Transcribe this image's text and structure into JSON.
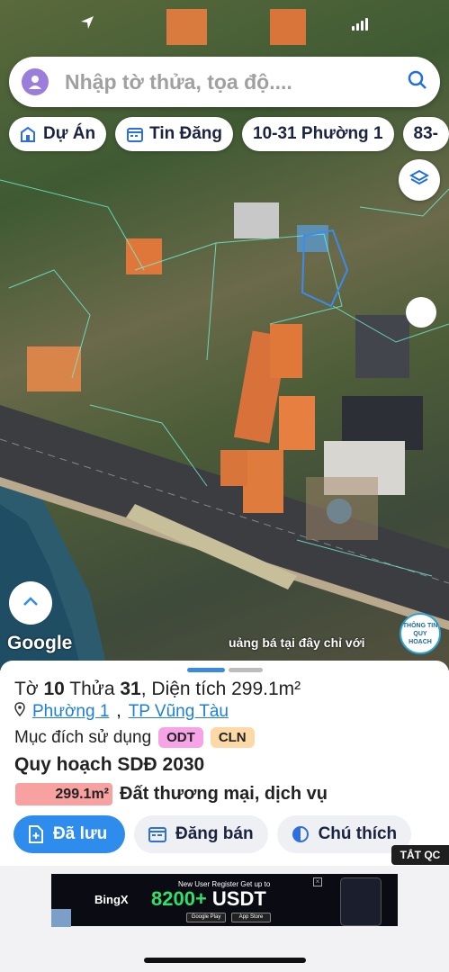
{
  "search": {
    "placeholder": "Nhập tờ thửa, tọa độ...."
  },
  "chips": [
    {
      "label": "Dự Án",
      "icon": "building-icon"
    },
    {
      "label": "Tin Đăng",
      "icon": "calendar-icon"
    },
    {
      "label": "10-31 Phường 1"
    },
    {
      "label": "83-"
    }
  ],
  "map": {
    "attribution": "Google",
    "ticker": "uảng bá tại đây chỉ với",
    "badge": "THÔNG TIN QUY HOẠCH"
  },
  "parcel": {
    "title_prefix": "Tờ",
    "sheet_no": "10",
    "plot_prefix": "Thửa",
    "plot_no": "31",
    "area_label": "Diện tích 299.1m²",
    "ward": "Phường 1",
    "city": "TP Vũng Tàu",
    "purpose_label": "Mục đích sử dụng",
    "tags": [
      "ODT",
      "CLN"
    ],
    "plan_title": "Quy hoạch SDĐ 2030",
    "plan_area": "299.1m²",
    "plan_use": "Đất thương mại, dịch vụ"
  },
  "actions": {
    "saved": "Đã lưu",
    "sell": "Đăng bán",
    "legend": "Chú thích"
  },
  "ad_close": "TẮT QC",
  "ad": {
    "brand": "BingX",
    "headline": "New User Register Get up to",
    "amount": "8200+",
    "currency": "USDT",
    "store1": "Google Play",
    "store2": "App Store"
  },
  "colors": {
    "primary": "#2e8cec",
    "odt": "#f6a4e6",
    "cln": "#fcd9a6",
    "plan_badge": "#f7a1a1"
  }
}
